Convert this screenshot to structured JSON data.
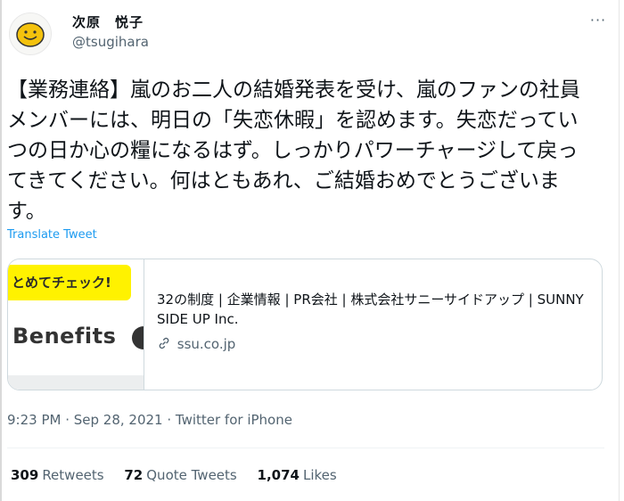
{
  "author": {
    "display_name": "次原　悦子",
    "handle": "@tsugihara"
  },
  "tweet": {
    "text": "【業務連絡】嵐のお二人の結婚発表を受け、嵐のファンの社員メンバーには、明日の「失恋休暇」を認めます。失恋だっていつの日か心の糧になるはず。しっかりパワーチャージして戻ってきてください。何はともあれ、ご結婚おめでとうございます。",
    "translate_label": "Translate Tweet",
    "timestamp": "9:23 PM · Sep 28, 2021 · Twitter for iPhone"
  },
  "card": {
    "sticker_text": "とめてチェック!",
    "image_text": "Benefits",
    "title": "32の制度 | 企業情報 | PR会社 | 株式会社サニーサイドアップ | SUNNY SIDE UP Inc.",
    "domain": "ssu.co.jp"
  },
  "stats": {
    "retweets_count": "309",
    "retweets_label": "Retweets",
    "quotes_count": "72",
    "quotes_label": "Quote Tweets",
    "likes_count": "1,074",
    "likes_label": "Likes"
  },
  "icons": {
    "more": "more-icon",
    "link": "link-icon",
    "avatar": "smiley-avatar-icon"
  },
  "colors": {
    "link_blue": "#1d9bf0",
    "secondary_text": "#536471",
    "sticker_yellow": "#fff200"
  }
}
